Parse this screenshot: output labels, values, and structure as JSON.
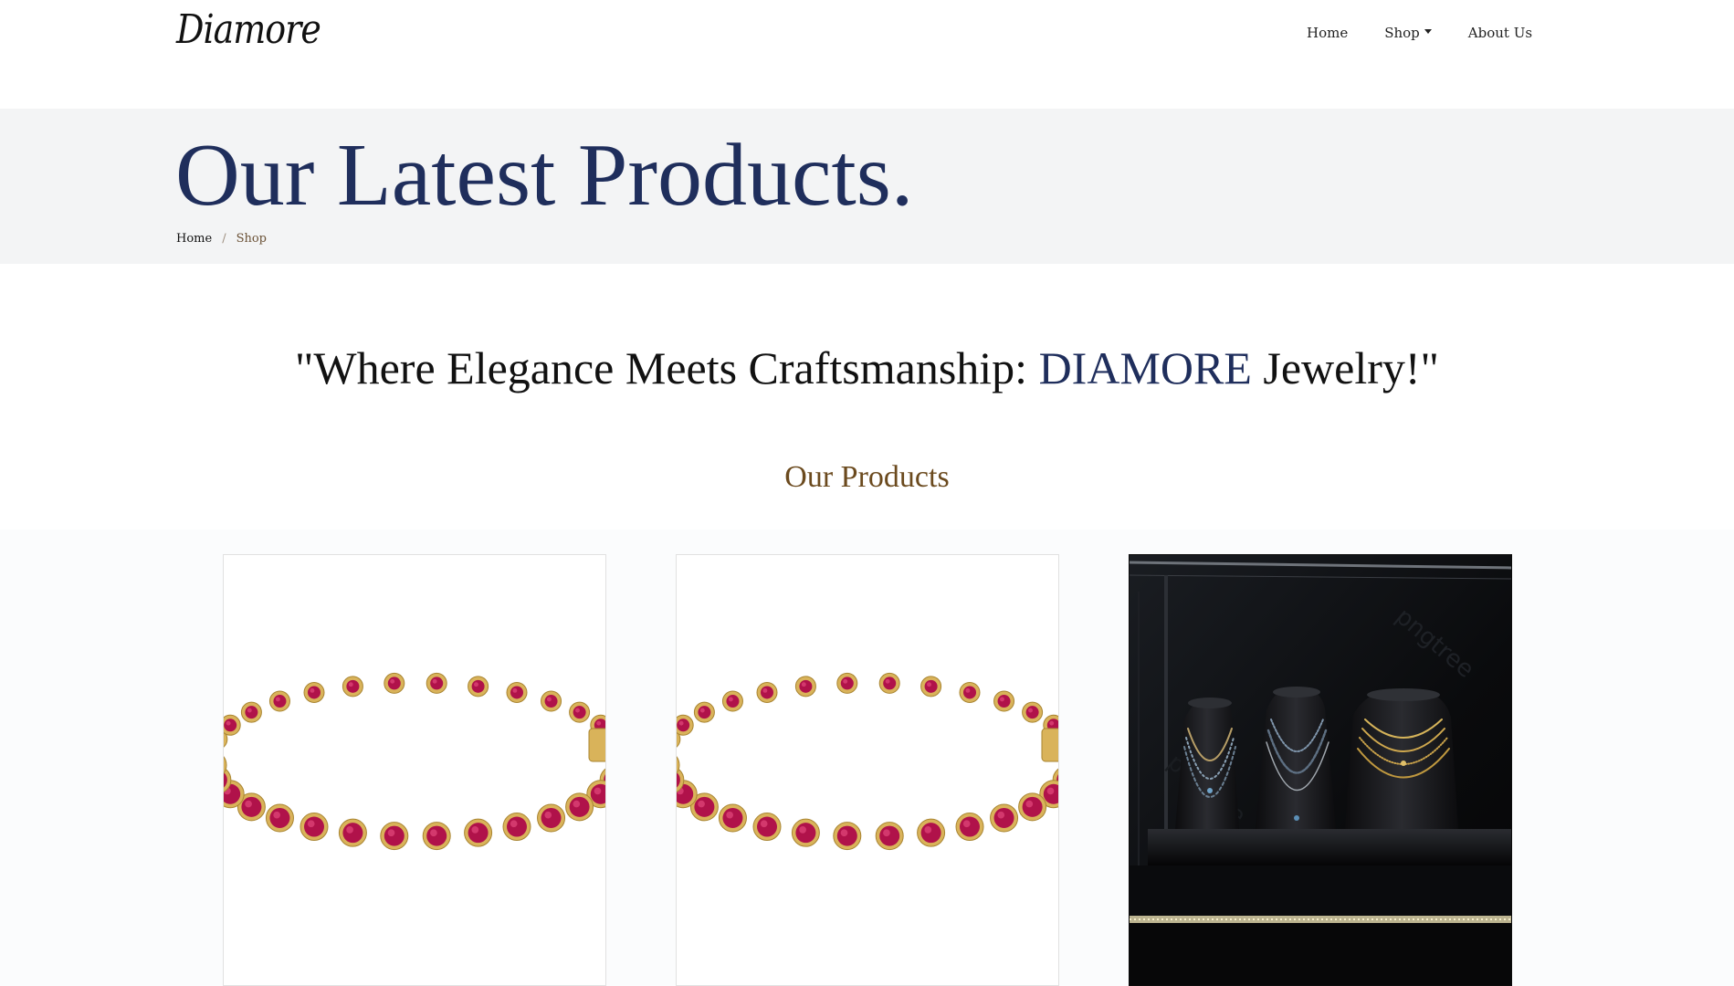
{
  "navbar": {
    "brand": "Diamore",
    "links": {
      "home": "Home",
      "shop": "Shop",
      "about": "About Us"
    }
  },
  "hero": {
    "title": "Our Latest Products.",
    "breadcrumb": {
      "home": "Home",
      "separator": "/",
      "current": "Shop"
    }
  },
  "tagline": {
    "prefix": "\"Where Elegance Meets Craftsmanship: ",
    "brand": "DIAMORE",
    "suffix": " Jewelry!\""
  },
  "products_section": {
    "heading": "Our Products",
    "items": [
      {
        "image": "ruby-gold-tennis-bracelet"
      },
      {
        "image": "ruby-gold-tennis-bracelet"
      },
      {
        "image": "necklaces-on-display-busts"
      }
    ]
  },
  "colors": {
    "navy": "#1f2e5c",
    "brown": "#6b4a1e",
    "hero_bg": "#f3f4f5",
    "ruby": "#b0124a",
    "gold": "#d9b35a"
  }
}
